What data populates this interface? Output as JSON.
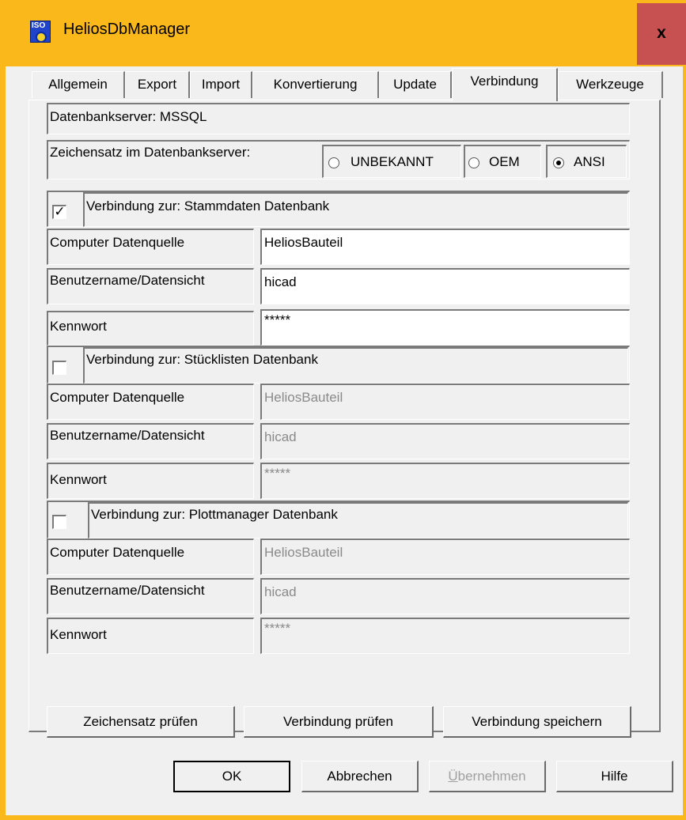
{
  "window": {
    "title": "HeliosDbManager",
    "close_label": "x",
    "app_icon_text": "ISO"
  },
  "tabs": [
    {
      "label": "Allgemein"
    },
    {
      "label": "Export"
    },
    {
      "label": "Import"
    },
    {
      "label": "Konvertierung"
    },
    {
      "label": "Update"
    },
    {
      "label": "Verbindung"
    },
    {
      "label": "Werkzeuge"
    }
  ],
  "active_tab": "Verbindung",
  "server": {
    "label": "Datenbankserver: MSSQL",
    "charset_label": "Zeichensatz im Datenbankserver:",
    "charset_options": [
      {
        "label": "UNBEKANNT",
        "selected": false
      },
      {
        "label": "OEM",
        "selected": false
      },
      {
        "label": "ANSI",
        "selected": true
      }
    ]
  },
  "connections": [
    {
      "title": "Verbindung zur: Stammdaten Datenbank",
      "checked": true,
      "check_glyph": "✓",
      "computer_label": "Computer Datenquelle",
      "computer_value": "HeliosBauteil",
      "user_label": "Benutzername/Datensicht",
      "user_value": "hicad",
      "password_label": "Kennwort",
      "password_value": "*****"
    },
    {
      "title": "Verbindung zur: Stücklisten Datenbank",
      "checked": false,
      "check_glyph": "",
      "computer_label": "Computer Datenquelle",
      "computer_value": "HeliosBauteil",
      "user_label": "Benutzername/Datensicht",
      "user_value": "hicad",
      "password_label": "Kennwort",
      "password_value": "*****"
    },
    {
      "title": "Verbindung zur: Plottmanager Datenbank",
      "checked": false,
      "check_glyph": "",
      "computer_label": "Computer Datenquelle",
      "computer_value": "HeliosBauteil",
      "user_label": "Benutzername/Datensicht",
      "user_value": "hicad",
      "password_label": "Kennwort",
      "password_value": "*****"
    }
  ],
  "actions": {
    "check_charset": "Zeichensatz prüfen",
    "check_connection": "Verbindung prüfen",
    "save_connection": "Verbindung speichern"
  },
  "footer": {
    "ok": "OK",
    "cancel": "Abbrechen",
    "apply_first": "Ü",
    "apply_rest": "bernehmen",
    "help": "Hilfe"
  },
  "colors": {
    "title_bar": "#fbb81b",
    "close_hover": "#c75050",
    "dialog_bg": "#f0f0f0"
  }
}
